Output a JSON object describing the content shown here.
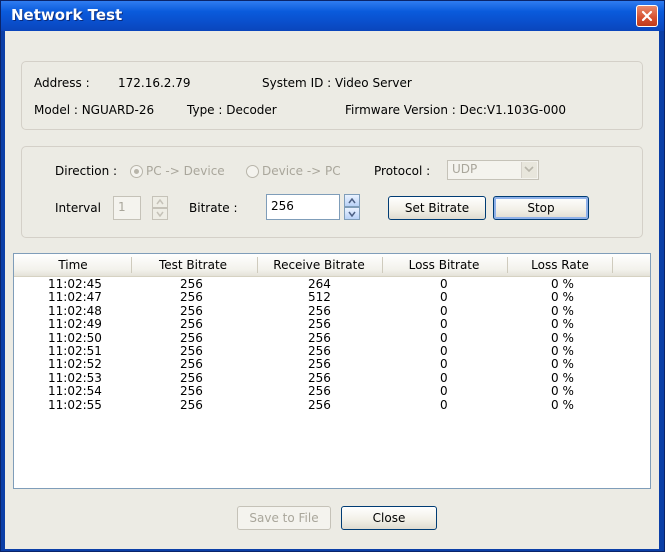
{
  "window": {
    "title": "Network Test",
    "close_icon": "close-icon"
  },
  "info": {
    "address_label": "Address :",
    "address_value": "172.16.2.79",
    "system_id": "System ID : Video Server",
    "model": "Model : NGUARD-26",
    "type": "Type : Decoder",
    "firmware": "Firmware Version : Dec:V1.103G-000"
  },
  "settings": {
    "direction_label": "Direction :",
    "direction_options": [
      "PC -> Device",
      "Device -> PC"
    ],
    "protocol_label": "Protocol :",
    "protocol_value": "UDP",
    "interval_label": "Interval",
    "interval_value": "1",
    "bitrate_label": "Bitrate :",
    "bitrate_value": "256",
    "set_bitrate_label": "Set Bitrate",
    "stop_label": "Stop"
  },
  "table": {
    "columns": [
      "Time",
      "Test Bitrate",
      "Receive Bitrate",
      "Loss Bitrate",
      "Loss Rate"
    ],
    "rows": [
      [
        "11:02:45",
        "256",
        "264",
        "0",
        "0 %"
      ],
      [
        "11:02:47",
        "256",
        "512",
        "0",
        "0 %"
      ],
      [
        "11:02:48",
        "256",
        "256",
        "0",
        "0 %"
      ],
      [
        "11:02:49",
        "256",
        "256",
        "0",
        "0 %"
      ],
      [
        "11:02:50",
        "256",
        "256",
        "0",
        "0 %"
      ],
      [
        "11:02:51",
        "256",
        "256",
        "0",
        "0 %"
      ],
      [
        "11:02:52",
        "256",
        "256",
        "0",
        "0 %"
      ],
      [
        "11:02:53",
        "256",
        "256",
        "0",
        "0 %"
      ],
      [
        "11:02:54",
        "256",
        "256",
        "0",
        "0 %"
      ],
      [
        "11:02:55",
        "256",
        "256",
        "0",
        "0 %"
      ]
    ]
  },
  "footer": {
    "save_label": "Save to File",
    "close_label": "Close"
  }
}
